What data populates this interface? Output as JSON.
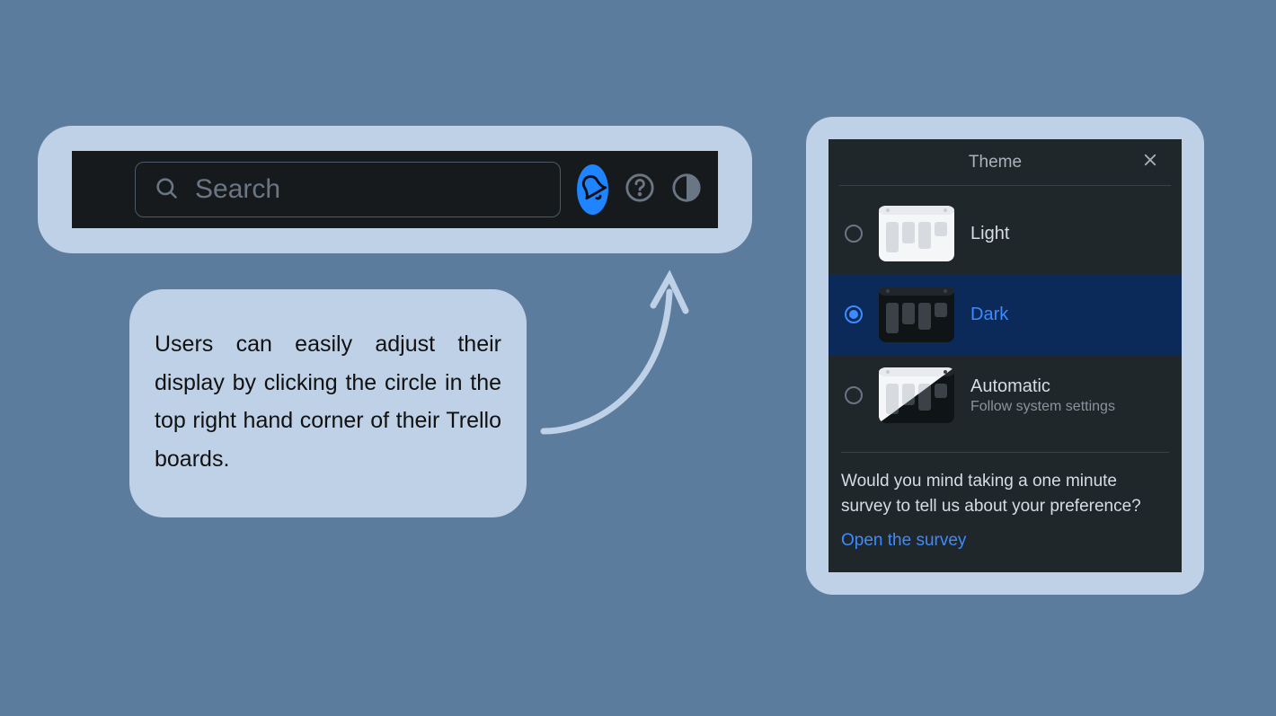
{
  "toolbar": {
    "search_placeholder": "Search"
  },
  "annotation": {
    "text": "Users can easily adjust their display by clicking the circle in the top right hand corner of their Trello boards."
  },
  "theme": {
    "title": "Theme",
    "options": {
      "light": {
        "label": "Light"
      },
      "dark": {
        "label": "Dark"
      },
      "automatic": {
        "label": "Automatic",
        "sub": "Follow system settings"
      }
    },
    "selected": "dark",
    "survey_text": "Would you mind taking a one minute survey to tell us about your preference?",
    "survey_link": "Open the survey"
  }
}
